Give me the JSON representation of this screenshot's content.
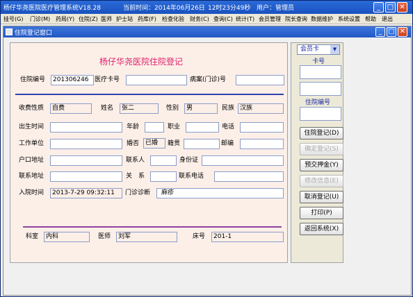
{
  "app": {
    "title": "杨仔华尧医院医疗管理系统V18.28",
    "time_label": "当前时间：2014年06月26日",
    "clock": "12时23分49秒",
    "user": "用户：管理员"
  },
  "menu": [
    "挂号(G)",
    "门诊(M)",
    "药局(Y)",
    "住院(Z)",
    "医师",
    "护士站",
    "药库(F)",
    "检查化验",
    "财务(C)",
    "查询(C)",
    "统计(T)",
    "会员管理",
    "院长查询",
    "数据维护",
    "系统设置",
    "帮助",
    "退出"
  ],
  "child": {
    "title": "住院登记窗口"
  },
  "form": {
    "title": "杨仔华尧医院住院登记",
    "labels": {
      "adm_no": "住院编号",
      "card_no": "医疗卡号",
      "record_no": "病案(门诊)号",
      "fee_type": "收费性质",
      "name": "姓名",
      "gender": "性别",
      "ethnicity": "民族",
      "birth": "出生时间",
      "age": "年龄",
      "job": "职业",
      "phone": "电话",
      "workplace": "工作单位",
      "marital": "婚否",
      "origin": "籍贯",
      "postcode": "邮编",
      "hukou": "户口地址",
      "contact": "联系人",
      "idcard": "身份证",
      "addr": "联系地址",
      "relation": "关　系",
      "contact_phone": "联系电话",
      "adm_time": "入院时间",
      "diagnosis": "门诊诊断",
      "dept": "科室",
      "doctor": "医师",
      "bed": "床号"
    },
    "values": {
      "adm_no": "201306246",
      "card_no": "",
      "record_no": "",
      "fee_type": "自费",
      "name": "张二",
      "gender": "男",
      "ethnicity": "汉族",
      "birth": "",
      "age": "",
      "job": "",
      "phone": "",
      "workplace": "",
      "marital": "已婚",
      "origin": "",
      "postcode": "",
      "hukou": "",
      "contact": "",
      "idcard": "",
      "addr": "",
      "relation": "",
      "contact_phone": "",
      "adm_time": "2013-7-29 09:32:11",
      "diagnosis": "麻疹",
      "dept": "内科",
      "doctor": "刘军",
      "bed": "201-1"
    }
  },
  "panel": {
    "select": "会员卡",
    "card_label": "卡号",
    "adm_label": "住院编号",
    "buttons": [
      "住院登记(D)",
      "确定登记(S)",
      "预交押金(Y)",
      "修改信息(E)",
      "取消登记(U)",
      "打印(P)",
      "返回系统(X)"
    ]
  },
  "colors": {
    "title_pink": "#e0206a",
    "rule_blue": "#3040b0",
    "rule_purple": "#9040a0",
    "form_bg": "#fcefe8"
  }
}
